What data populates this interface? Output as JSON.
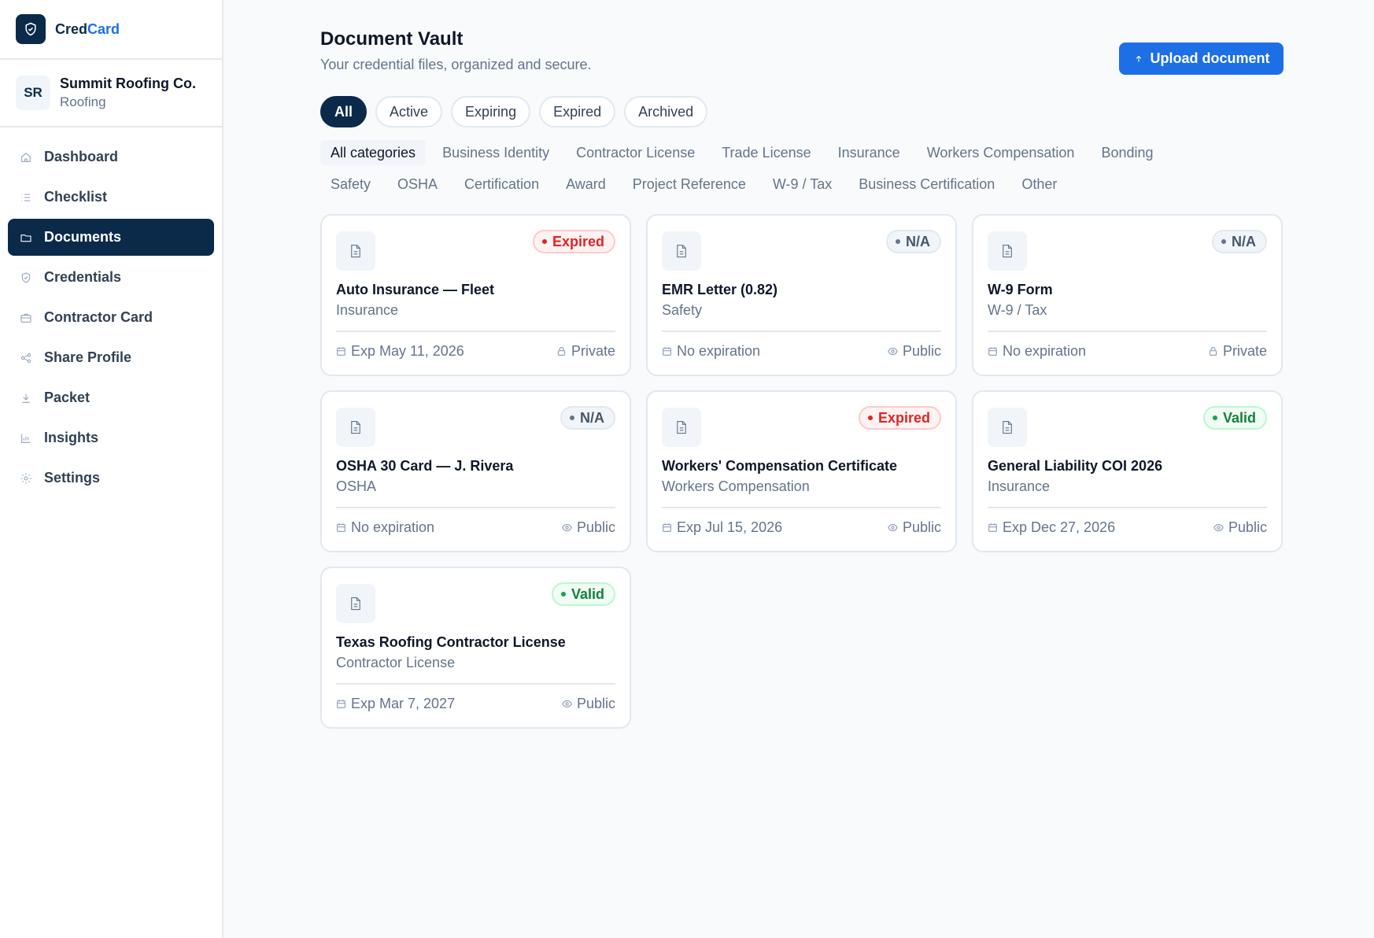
{
  "brand": {
    "name_a": "Cred",
    "name_b": "Card"
  },
  "company": {
    "initials": "SR",
    "name": "Summit Roofing Co.",
    "type": "Roofing"
  },
  "nav": [
    {
      "label": "Dashboard",
      "icon": "home-icon",
      "active": false
    },
    {
      "label": "Checklist",
      "icon": "list-icon",
      "active": false
    },
    {
      "label": "Documents",
      "icon": "folder-icon",
      "active": true
    },
    {
      "label": "Credentials",
      "icon": "shield-icon",
      "active": false
    },
    {
      "label": "Contractor Card",
      "icon": "card-icon",
      "active": false
    },
    {
      "label": "Share Profile",
      "icon": "share-icon",
      "active": false
    },
    {
      "label": "Packet",
      "icon": "download-icon",
      "active": false
    },
    {
      "label": "Insights",
      "icon": "bar-chart-icon",
      "active": false
    },
    {
      "label": "Settings",
      "icon": "gear-icon",
      "active": false
    }
  ],
  "header": {
    "title": "Document Vault",
    "subtitle": "Your credential files, organized and secure.",
    "upload_label": "Upload document"
  },
  "status_tabs": [
    {
      "label": "All",
      "active": true
    },
    {
      "label": "Active",
      "active": false
    },
    {
      "label": "Expiring",
      "active": false
    },
    {
      "label": "Expired",
      "active": false
    },
    {
      "label": "Archived",
      "active": false
    }
  ],
  "categories_row1": [
    {
      "label": "All categories",
      "active": true
    },
    {
      "label": "Business Identity",
      "active": false
    },
    {
      "label": "Contractor License",
      "active": false
    },
    {
      "label": "Trade License",
      "active": false
    },
    {
      "label": "Insurance",
      "active": false
    },
    {
      "label": "Workers Compensation",
      "active": false
    },
    {
      "label": "Bonding",
      "active": false
    }
  ],
  "categories_row2": [
    {
      "label": "Safety",
      "active": false
    },
    {
      "label": "OSHA",
      "active": false
    },
    {
      "label": "Certification",
      "active": false
    },
    {
      "label": "Award",
      "active": false
    },
    {
      "label": "Project Reference",
      "active": false
    },
    {
      "label": "W-9 / Tax",
      "active": false
    },
    {
      "label": "Business Certification",
      "active": false
    },
    {
      "label": "Other",
      "active": false
    }
  ],
  "documents": [
    {
      "title": "Auto Insurance — Fleet",
      "category": "Insurance",
      "status": "Expired",
      "status_kind": "expired",
      "expiration": "Exp May 11, 2026",
      "visibility": "Private"
    },
    {
      "title": "EMR Letter (0.82)",
      "category": "Safety",
      "status": "N/A",
      "status_kind": "na",
      "expiration": "No expiration",
      "visibility": "Public"
    },
    {
      "title": "W-9 Form",
      "category": "W-9 / Tax",
      "status": "N/A",
      "status_kind": "na",
      "expiration": "No expiration",
      "visibility": "Private"
    },
    {
      "title": "OSHA 30 Card — J. Rivera",
      "category": "OSHA",
      "status": "N/A",
      "status_kind": "na",
      "expiration": "No expiration",
      "visibility": "Public"
    },
    {
      "title": "Workers' Compensation Certificate",
      "category": "Workers Compensation",
      "status": "Expired",
      "status_kind": "expired",
      "expiration": "Exp Jul 15, 2026",
      "visibility": "Public"
    },
    {
      "title": "General Liability COI 2026",
      "category": "Insurance",
      "status": "Valid",
      "status_kind": "valid",
      "expiration": "Exp Dec 27, 2026",
      "visibility": "Public"
    },
    {
      "title": "Texas Roofing Contractor License",
      "category": "Contractor License",
      "status": "Valid",
      "status_kind": "valid",
      "expiration": "Exp Mar 7, 2027",
      "visibility": "Public"
    }
  ],
  "colors": {
    "navy": "#0b2a4a",
    "accent": "#1d6fe6",
    "expired": "#dc2626",
    "valid": "#15803d"
  }
}
